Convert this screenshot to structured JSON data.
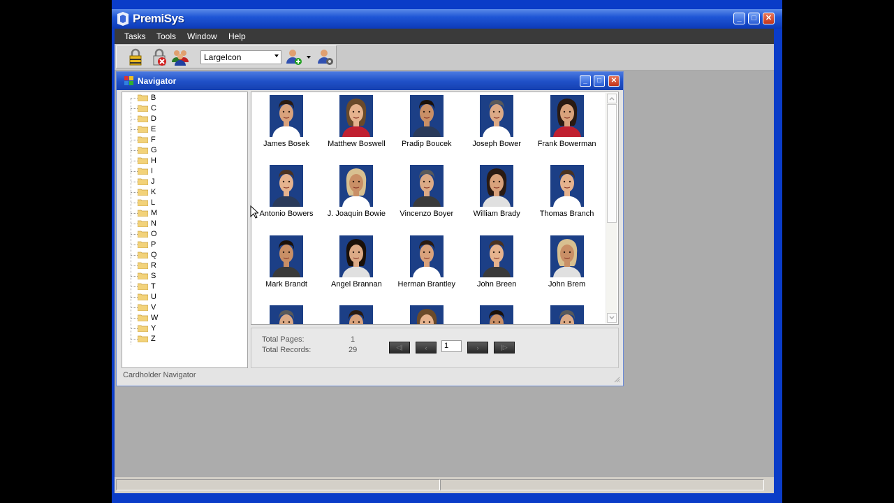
{
  "app": {
    "title": "PremiSys"
  },
  "menu": [
    {
      "label": "Tasks"
    },
    {
      "label": "Tools"
    },
    {
      "label": "Window"
    },
    {
      "label": "Help"
    }
  ],
  "toolbar": {
    "view_mode": "LargeIcon",
    "icons": [
      "lock-icon",
      "unlock-icon",
      "group-icon",
      "add-cardholder-icon",
      "cardholder-settings-icon"
    ]
  },
  "navigator": {
    "title": "Cardholder Navigator",
    "window_title": "Navigator",
    "tree": [
      "B",
      "C",
      "D",
      "E",
      "F",
      "G",
      "H",
      "I",
      "J",
      "K",
      "L",
      "M",
      "N",
      "O",
      "P",
      "Q",
      "R",
      "S",
      "T",
      "U",
      "V",
      "W",
      "Y",
      "Z"
    ],
    "cardholders": [
      {
        "name": "James Bosek",
        "photo": "man"
      },
      {
        "name": "Matthew Boswell",
        "photo": "woman"
      },
      {
        "name": "Pradip Boucek",
        "photo": "man"
      },
      {
        "name": "Joseph Bower",
        "photo": "man"
      },
      {
        "name": "Frank Bowerman",
        "photo": "woman"
      },
      {
        "name": "Antonio Bowers",
        "photo": "man"
      },
      {
        "name": "J. Joaquin Bowie",
        "photo": "woman"
      },
      {
        "name": "Vincenzo Boyer",
        "photo": "man"
      },
      {
        "name": "William Brady",
        "photo": "woman"
      },
      {
        "name": "Thomas Branch",
        "photo": "man"
      },
      {
        "name": "Mark Brandt",
        "photo": "man"
      },
      {
        "name": "Angel Brannan",
        "photo": "woman"
      },
      {
        "name": "Herman Brantley",
        "photo": "man"
      },
      {
        "name": "John Breen",
        "photo": "man"
      },
      {
        "name": "John Brem",
        "photo": "woman"
      },
      {
        "name": "",
        "photo": "man"
      },
      {
        "name": "",
        "photo": "man"
      },
      {
        "name": "",
        "photo": "woman"
      },
      {
        "name": "",
        "photo": "man"
      },
      {
        "name": "",
        "photo": "man"
      }
    ],
    "pager": {
      "total_pages_label": "Total Pages:",
      "total_pages": "1",
      "total_records_label": "Total Records:",
      "total_records": "29",
      "current_page": "1"
    }
  },
  "colors": {
    "title_bar": "#1f56d6",
    "menu_bar": "#3a3a3a",
    "workspace": "#acacac",
    "photo_bg": "#1c3f86"
  }
}
